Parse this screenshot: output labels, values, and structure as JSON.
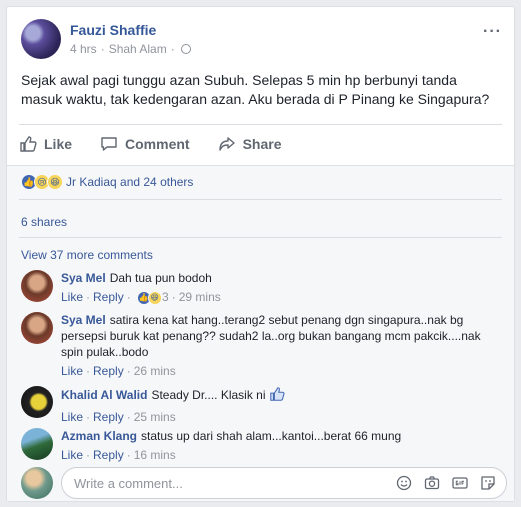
{
  "post": {
    "author": "Fauzi Shaffie",
    "time": "4 hrs",
    "location": "Shah Alam",
    "dot": "·",
    "more": "···",
    "text": "Sejak awal pagi tunggu azan Subuh. Selepas 5 min hp berbunyi tanda masuk waktu, tak kedengaran azan. Aku berada di P Pinang ke Singapura?"
  },
  "actions": {
    "like": "Like",
    "comment": "Comment",
    "share": "Share"
  },
  "reactions": {
    "text": "Jr Kadiaq and 24 others"
  },
  "shares": "6 shares",
  "view_more": "View 37 more comments",
  "comments": [
    {
      "name": "Sya Mel",
      "text": "Dah tua pun bodoh",
      "like": "Like",
      "reply": "Reply",
      "reaction_count": "3",
      "time": "29 mins"
    },
    {
      "name": "Sya Mel",
      "text": "satira kena kat hang..terang2 sebut penang dgn singapura..nak bg persepsi buruk kat penang?? sudah2 la..org bukan bangang mcm pakcik....nak spin pulak..bodo",
      "like": "Like",
      "reply": "Reply",
      "time": "26 mins"
    },
    {
      "name": "Khalid Al Walid",
      "text": "Steady Dr.... Klasik ni",
      "like": "Like",
      "reply": "Reply",
      "time": "25 mins"
    },
    {
      "name": "Azman Klang",
      "text": "status up dari shah alam...kantoi...berat 66 mung",
      "like": "Like",
      "reply": "Reply",
      "time": "16 mins"
    }
  ],
  "write": {
    "placeholder": "Write a comment..."
  },
  "colors": {
    "link": "#385898",
    "like_blue": "#4267b2",
    "gray_text": "#90949c"
  }
}
